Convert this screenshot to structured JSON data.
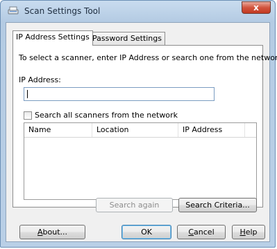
{
  "window": {
    "title": "Scan Settings Tool",
    "close_glyph": "x",
    "app_icon": "scanner-icon"
  },
  "tabs": [
    {
      "label": "IP Address Settings",
      "active": true
    },
    {
      "label": "Password Settings",
      "active": false
    }
  ],
  "panel": {
    "instruction": "To select a scanner, enter IP Address or search one from the network.",
    "ip_label": "IP Address:",
    "ip_value": "",
    "search_all_label": "Search all scanners from the network",
    "search_all_checked": false,
    "columns": [
      "Name",
      "Location",
      "IP Address"
    ],
    "rows": []
  },
  "buttons": {
    "search_again": "Search again",
    "search_criteria": "Search Criteria...",
    "about": "About...",
    "ok": "OK",
    "cancel": "Cancel",
    "help": "Help"
  },
  "colors": {
    "close_button": "#c9452c",
    "frame": "#b9cfe6"
  }
}
